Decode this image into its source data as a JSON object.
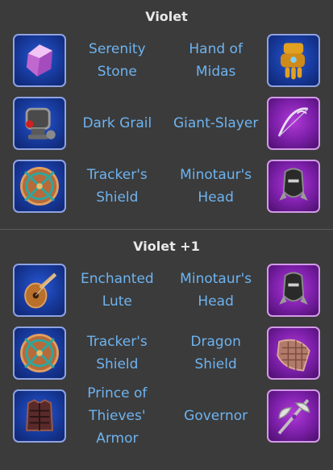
{
  "sections": [
    {
      "title": "Violet",
      "rows": [
        {
          "left_icon": "serenity-stone-icon",
          "left_name": "Serenity Stone",
          "right_name": "Hand of Midas",
          "right_icon": "hand-of-midas-icon"
        },
        {
          "left_icon": "dark-grail-icon",
          "left_name": "Dark Grail",
          "right_name": "Giant-Slayer",
          "right_icon": "giant-slayer-icon"
        },
        {
          "left_icon": "trackers-shield-icon",
          "left_name": "Tracker's Shield",
          "right_name": "Minotaur's Head",
          "right_icon": "minotaurs-head-icon"
        }
      ]
    },
    {
      "title": "Violet +1",
      "rows": [
        {
          "left_icon": "enchanted-lute-icon",
          "left_name": "Enchanted Lute",
          "right_name": "Minotaur's Head",
          "right_icon": "minotaurs-head-icon"
        },
        {
          "left_icon": "trackers-shield-icon",
          "left_name": "Tracker's Shield",
          "right_name": "Dragon Shield",
          "right_icon": "dragon-shield-icon"
        },
        {
          "left_icon": "prince-of-thieves-armor-icon",
          "left_name": "Prince of Thieves' Armor",
          "right_name": "Governor",
          "right_icon": "governor-icon"
        }
      ]
    }
  ]
}
